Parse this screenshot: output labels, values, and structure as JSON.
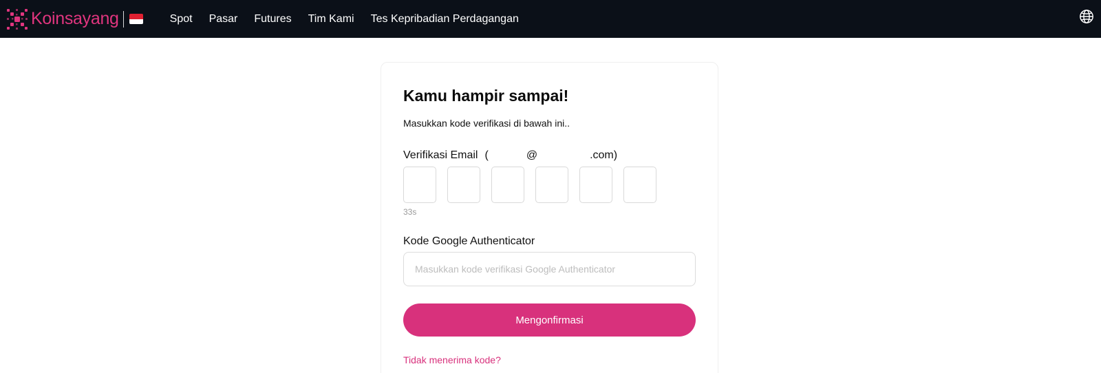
{
  "header": {
    "brand_name": "Koinsayang",
    "brand_color": "#e0357e",
    "background": "#0b1018",
    "flag_icon": "indonesia-flag-icon",
    "nav": [
      {
        "label": "Spot"
      },
      {
        "label": "Pasar"
      },
      {
        "label": "Futures"
      },
      {
        "label": "Tim Kami"
      },
      {
        "label": "Tes Kepribadian Perdagangan"
      }
    ],
    "language_icon": "globe-icon"
  },
  "form": {
    "title": "Kamu hampir sampai!",
    "subtitle": "Masukkan kode verifikasi di bawah ini..",
    "email_verification": {
      "label": "Verifikasi Email",
      "paren_open": "(",
      "at": "@",
      "domain_suffix": ".com)",
      "otp_digits": [
        "",
        "",
        "",
        "",
        "",
        ""
      ],
      "countdown": "33s"
    },
    "google_auth": {
      "label": "Kode Google Authenticator",
      "value": "",
      "placeholder": "Masukkan kode verifikasi Google Authenticator"
    },
    "confirm_label": "Mengonfirmasi",
    "resend_label": "Tidak menerima kode?",
    "accent_color": "#d8317c"
  }
}
